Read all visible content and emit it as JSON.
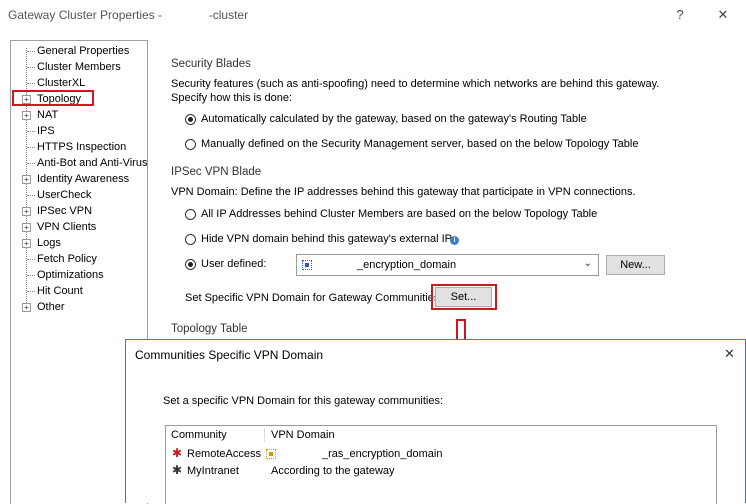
{
  "window": {
    "title": "Gateway Cluster Properties -              -cluster",
    "help": "?",
    "close": "✕"
  },
  "tree": {
    "items": [
      {
        "label": "General Properties",
        "expandable": false
      },
      {
        "label": "Cluster Members",
        "expandable": false
      },
      {
        "label": "ClusterXL",
        "expandable": false
      },
      {
        "label": "Topology",
        "expandable": true
      },
      {
        "label": "NAT",
        "expandable": true
      },
      {
        "label": "IPS",
        "expandable": false
      },
      {
        "label": "HTTPS Inspection",
        "expandable": false
      },
      {
        "label": "Anti-Bot and Anti-Virus",
        "expandable": false
      },
      {
        "label": "Identity Awareness",
        "expandable": true
      },
      {
        "label": "UserCheck",
        "expandable": false
      },
      {
        "label": "IPSec VPN",
        "expandable": true
      },
      {
        "label": "VPN Clients",
        "expandable": true
      },
      {
        "label": "Logs",
        "expandable": true
      },
      {
        "label": "Fetch Policy",
        "expandable": false
      },
      {
        "label": "Optimizations",
        "expandable": false
      },
      {
        "label": "Hit Count",
        "expandable": false
      },
      {
        "label": "Other",
        "expandable": true
      }
    ]
  },
  "security_blades": {
    "heading": "Security Blades",
    "desc1": "Security features (such as anti-spoofing) need to determine which networks are behind this gateway.",
    "desc2": "Specify how this is done:",
    "option_auto": "Automatically calculated by the gateway, based on the gateway's Routing Table",
    "option_manual": "Manually defined on the Security Management server, based on the below Topology Table"
  },
  "ipsec": {
    "heading": "IPSec VPN Blade",
    "desc": "VPN Domain: Define the IP addresses behind this gateway that participate in VPN connections.",
    "option_all": "All IP Addresses behind Cluster Members are based on the below Topology Table",
    "option_hide": "Hide VPN domain behind this gateway's external IP.",
    "option_user": "User defined:",
    "domain_value": "_encryption_domain",
    "new_button": "New...",
    "communities_label": "Set Specific VPN Domain for Gateway Communities:",
    "set_button": "Set..."
  },
  "topology_table": {
    "heading": "Topology Table"
  },
  "dialog": {
    "title": "Communities Specific VPN Domain",
    "close": "✕",
    "desc": "Set a specific VPN Domain for this gateway communities:",
    "columns": [
      "Community",
      "VPN Domain"
    ],
    "rows": [
      {
        "community": "RemoteAccess",
        "domain": "_ras_encryption_domain"
      },
      {
        "community": "MyIntranet",
        "domain": "According to the gateway"
      }
    ]
  },
  "colors": {
    "highlight": "#d0181e",
    "dialog_border": "#1e88c8"
  }
}
